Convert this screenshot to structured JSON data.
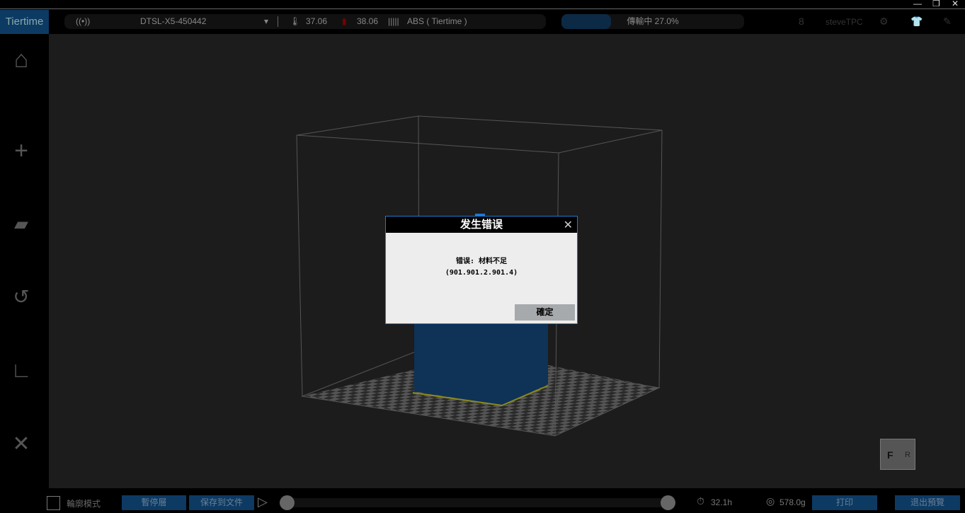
{
  "window": {
    "minimize": "—",
    "restore": "❐",
    "close": "✕"
  },
  "topbar": {
    "logo": "Tiertime",
    "printer_name": "DTSL-X5-450442",
    "nozzle_temp": "37.06",
    "bed_temp": "38.06",
    "material": "ABS ( Tiertime )",
    "transfer_status": "傳輸中 27.0%",
    "transfer_progress": 27.0,
    "username": "steveTPC"
  },
  "sidebar": [
    "home",
    "add",
    "layers",
    "rotate",
    "measure",
    "tools"
  ],
  "dialog": {
    "title": "发生错误",
    "message": "错误: 材料不足",
    "code": "(901.901.2.901.4)",
    "ok": "確定"
  },
  "viewcube": {
    "front": "F",
    "right": "R"
  },
  "bottombar": {
    "outline_mode": "輪廓模式",
    "pause_layer": "暫停層",
    "save_to_file": "保存到文件",
    "time": "32.1h",
    "weight": "578.0g",
    "print": "打印",
    "exit_preview": "退出預覽"
  },
  "colors": {
    "accent": "#0c3a63",
    "dialog_border": "#1e7ad4",
    "model": "#0f3257"
  }
}
